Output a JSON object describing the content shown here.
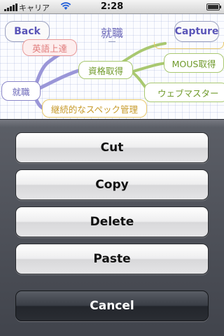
{
  "status_bar": {
    "carrier": "キャリア",
    "time": "2:28"
  },
  "header": {
    "back_label": "Back",
    "title": "就職",
    "capture_label": "Capture"
  },
  "mindmap": {
    "nodes": {
      "root": "就職",
      "english": "英語上達",
      "qualification": "資格取得",
      "mous": "MOUS取得",
      "web_master": "ウェブマスター",
      "spec_management": "継続的なスペック管理"
    }
  },
  "action_sheet": {
    "buttons": [
      "Cut",
      "Copy",
      "Delete",
      "Paste"
    ],
    "cancel": "Cancel"
  },
  "colors": {
    "title_purple": "#6a66b8",
    "node_pink": "#e89a9a",
    "node_green": "#a9c870",
    "node_yellow": "#e8c86a",
    "node_purple": "#8a86c8",
    "link_purple": "#9a96d8"
  }
}
